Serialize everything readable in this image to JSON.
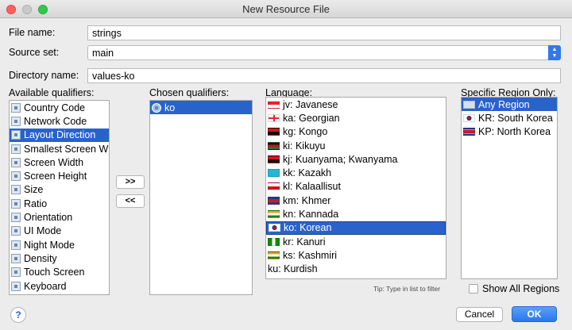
{
  "window": {
    "title": "New Resource File"
  },
  "form": {
    "file_name": {
      "label": "File name:",
      "value": "strings"
    },
    "source_set": {
      "label": "Source set:",
      "value": "main"
    },
    "directory_name": {
      "label": "Directory name:",
      "value": "values-ko"
    }
  },
  "qualifiers": {
    "available_label": "Available qualifiers:",
    "available": [
      {
        "label": "Country Code",
        "icon": "country-code-icon",
        "selected": false
      },
      {
        "label": "Network Code",
        "icon": "network-code-icon",
        "selected": false
      },
      {
        "label": "Layout Direction",
        "icon": "layout-direction-icon",
        "selected": true
      },
      {
        "label": "Smallest Screen Wid",
        "icon": "smallest-screen-width-icon",
        "selected": false
      },
      {
        "label": "Screen Width",
        "icon": "screen-width-icon",
        "selected": false
      },
      {
        "label": "Screen Height",
        "icon": "screen-height-icon",
        "selected": false
      },
      {
        "label": "Size",
        "icon": "size-icon",
        "selected": false
      },
      {
        "label": "Ratio",
        "icon": "ratio-icon",
        "selected": false
      },
      {
        "label": "Orientation",
        "icon": "orientation-icon",
        "selected": false
      },
      {
        "label": "UI Mode",
        "icon": "ui-mode-icon",
        "selected": false
      },
      {
        "label": "Night Mode",
        "icon": "night-mode-icon",
        "selected": false
      },
      {
        "label": "Density",
        "icon": "density-icon",
        "selected": false
      },
      {
        "label": "Touch Screen",
        "icon": "touch-screen-icon",
        "selected": false
      },
      {
        "label": "Keyboard",
        "icon": "keyboard-icon",
        "selected": false
      }
    ],
    "chosen_label": "Chosen qualifiers:",
    "chosen": [
      {
        "label": "ko",
        "icon": "globe-icon",
        "selected": true
      }
    ],
    "add_label": ">>",
    "remove_label": "<<"
  },
  "language": {
    "label": "Language:",
    "items": [
      {
        "label": "jv: Javanese",
        "flag": "flag-jv"
      },
      {
        "label": "ka: Georgian",
        "flag": "flag-ka"
      },
      {
        "label": "kg: Kongo",
        "flag": "flag-kg"
      },
      {
        "label": "ki: Kikuyu",
        "flag": "flag-ki"
      },
      {
        "label": "kj: Kuanyama; Kwanyama",
        "flag": "flag-kj"
      },
      {
        "label": "kk: Kazakh",
        "flag": "flag-kk"
      },
      {
        "label": "kl: Kalaallisut",
        "flag": "flag-kl"
      },
      {
        "label": "km: Khmer",
        "flag": "flag-km"
      },
      {
        "label": "kn: Kannada",
        "flag": "flag-kn"
      },
      {
        "label": "ko: Korean",
        "flag": "flag-ko",
        "selected": true
      },
      {
        "label": "kr: Kanuri",
        "flag": "flag-kr"
      },
      {
        "label": "ks: Kashmiri",
        "flag": "flag-ks"
      },
      {
        "label": "ku: Kurdish",
        "flag": ""
      }
    ],
    "tip": "Tip: Type in list to filter"
  },
  "region": {
    "label": "Specific Region Only:",
    "items": [
      {
        "label": "Any Region",
        "flag": "flag-any",
        "selected": true
      },
      {
        "label": "KR: South Korea",
        "flag": "flag-kr-region"
      },
      {
        "label": "KP: North Korea",
        "flag": "flag-kp"
      }
    ],
    "show_all_label": "Show All Regions"
  },
  "buttons": {
    "help": "?",
    "cancel": "Cancel",
    "ok": "OK"
  },
  "colors": {
    "selection": "#2a62cc",
    "ok_button": "#2a76ee",
    "window_bg": "#ececec"
  }
}
